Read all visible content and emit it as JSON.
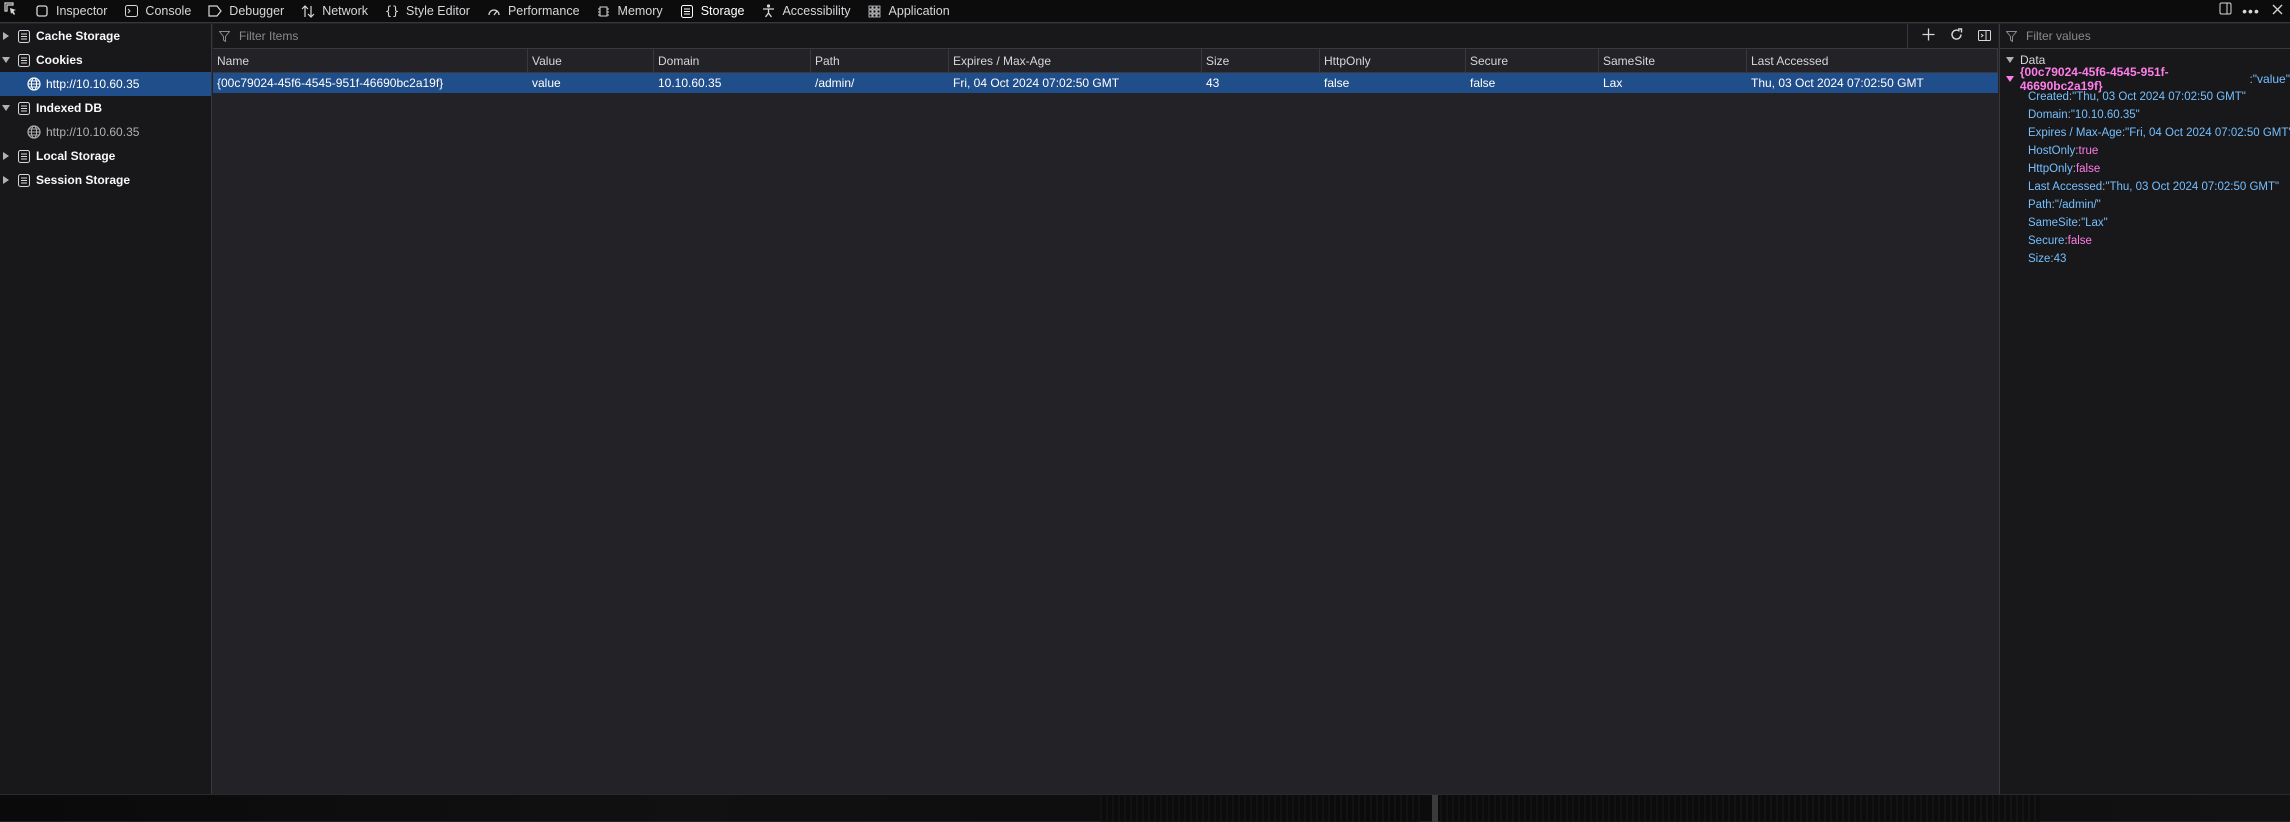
{
  "toolbar": {
    "tabs": [
      {
        "label": "Inspector",
        "icon": "inspector-icon"
      },
      {
        "label": "Console",
        "icon": "console-icon"
      },
      {
        "label": "Debugger",
        "icon": "debugger-icon"
      },
      {
        "label": "Network",
        "icon": "network-icon"
      },
      {
        "label": "Style Editor",
        "icon": "style-editor-icon"
      },
      {
        "label": "Performance",
        "icon": "performance-icon"
      },
      {
        "label": "Memory",
        "icon": "memory-icon"
      },
      {
        "label": "Storage",
        "icon": "storage-icon",
        "active": true
      },
      {
        "label": "Accessibility",
        "icon": "accessibility-icon"
      },
      {
        "label": "Application",
        "icon": "application-icon"
      }
    ]
  },
  "sidebar": {
    "items": [
      {
        "label": "Cache Storage",
        "expanded": false
      },
      {
        "label": "Cookies",
        "expanded": true,
        "children": [
          {
            "label": "http://10.10.60.35",
            "selected": true
          }
        ]
      },
      {
        "label": "Indexed DB",
        "expanded": true,
        "children": [
          {
            "label": "http://10.10.60.35",
            "selected": false
          }
        ]
      },
      {
        "label": "Local Storage",
        "expanded": false
      },
      {
        "label": "Session Storage",
        "expanded": false
      }
    ]
  },
  "main": {
    "filter_placeholder": "Filter Items",
    "columns": [
      "Name",
      "Value",
      "Domain",
      "Path",
      "Expires / Max-Age",
      "Size",
      "HttpOnly",
      "Secure",
      "SameSite",
      "Last Accessed"
    ],
    "rows": [
      [
        "{00c79024-45f6-4545-951f-46690bc2a19f}",
        "value",
        "10.10.60.35",
        "/admin/",
        "Fri, 04 Oct 2024 07:02:50 GMT",
        "43",
        "false",
        "false",
        "Lax",
        "Thu, 03 Oct 2024 07:02:50 GMT"
      ]
    ]
  },
  "datapanel": {
    "filter_placeholder": "Filter values",
    "header": "Data",
    "root_key": "{00c79024-45f6-4545-951f-46690bc2a19f}",
    "root_value": "\"value\"",
    "entries": [
      {
        "key": "Created",
        "value": "\"Thu, 03 Oct 2024 07:02:50 GMT\"",
        "type": "str"
      },
      {
        "key": "Domain",
        "value": "\"10.10.60.35\"",
        "type": "str"
      },
      {
        "key": "Expires / Max-Age",
        "value": "\"Fri, 04 Oct 2024 07:02:50 GMT\"",
        "type": "str"
      },
      {
        "key": "HostOnly",
        "value": "true",
        "type": "bool"
      },
      {
        "key": "HttpOnly",
        "value": "false",
        "type": "bool"
      },
      {
        "key": "Last Accessed",
        "value": "\"Thu, 03 Oct 2024 07:02:50 GMT\"",
        "type": "str"
      },
      {
        "key": "Path",
        "value": "\"/admin/\"",
        "type": "str"
      },
      {
        "key": "SameSite",
        "value": "\"Lax\"",
        "type": "str"
      },
      {
        "key": "Secure",
        "value": "false",
        "type": "bool"
      },
      {
        "key": "Size",
        "value": "43",
        "type": "num"
      }
    ]
  },
  "colors": {
    "selected_row": "#204e8a",
    "string_value": "#75bfff",
    "keyword_value": "#ff7de9"
  }
}
